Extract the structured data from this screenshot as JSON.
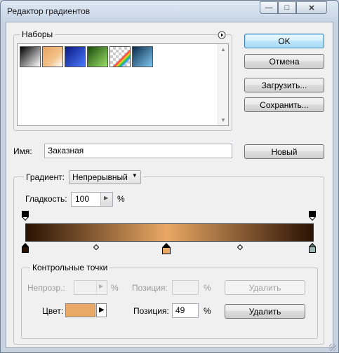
{
  "window": {
    "title": "Редактор градиентов",
    "controls": {
      "minimize": "—",
      "maximize": "□",
      "close": "✕"
    }
  },
  "presets": {
    "label": "Наборы",
    "menu_icon": "circle-arrow-right-icon",
    "swatches": [
      {
        "name": "black-white-diagonal",
        "colors": [
          "#000000",
          "#ffffff"
        ]
      },
      {
        "name": "copper-transparent",
        "colors": [
          "#e8a060",
          "#ffffff"
        ]
      },
      {
        "name": "blue-navy",
        "colors": [
          "#0a1a80",
          "#4a78ff"
        ]
      },
      {
        "name": "green-black",
        "colors": [
          "#1a4a0a",
          "#9adf6a"
        ]
      },
      {
        "name": "transparent-rainbow",
        "colors": [
          "#ff3030",
          "#30ff30"
        ]
      },
      {
        "name": "blue-steel",
        "colors": [
          "#0a2a4a",
          "#7fc8f0"
        ]
      }
    ]
  },
  "buttons": {
    "ok": "OK",
    "cancel": "Отмена",
    "load": "Загрузить...",
    "save": "Сохранить...",
    "new": "Новый",
    "delete_opacity": "Удалить",
    "delete_color": "Удалить"
  },
  "name": {
    "label": "Имя:",
    "value": "Заказная"
  },
  "gradient": {
    "type_label": "Градиент:",
    "type_value": "Непрерывный",
    "smoothness_label": "Гладкость:",
    "smoothness_value": "100",
    "smoothness_unit": "%",
    "colors": [
      "#2a1203",
      "#e9a865",
      "#2a1203"
    ]
  },
  "stops": {
    "group_label": "Контрольные точки",
    "opacity_label": "Непрозр.:",
    "opacity_value": "",
    "opacity_unit": "%",
    "opacity_location_label": "Позиция:",
    "opacity_location_value": "",
    "opacity_location_unit": "%",
    "color_label": "Цвет:",
    "color_value": "#e9a865",
    "color_location_label": "Позиция:",
    "color_location_value": "49",
    "color_location_unit": "%"
  }
}
